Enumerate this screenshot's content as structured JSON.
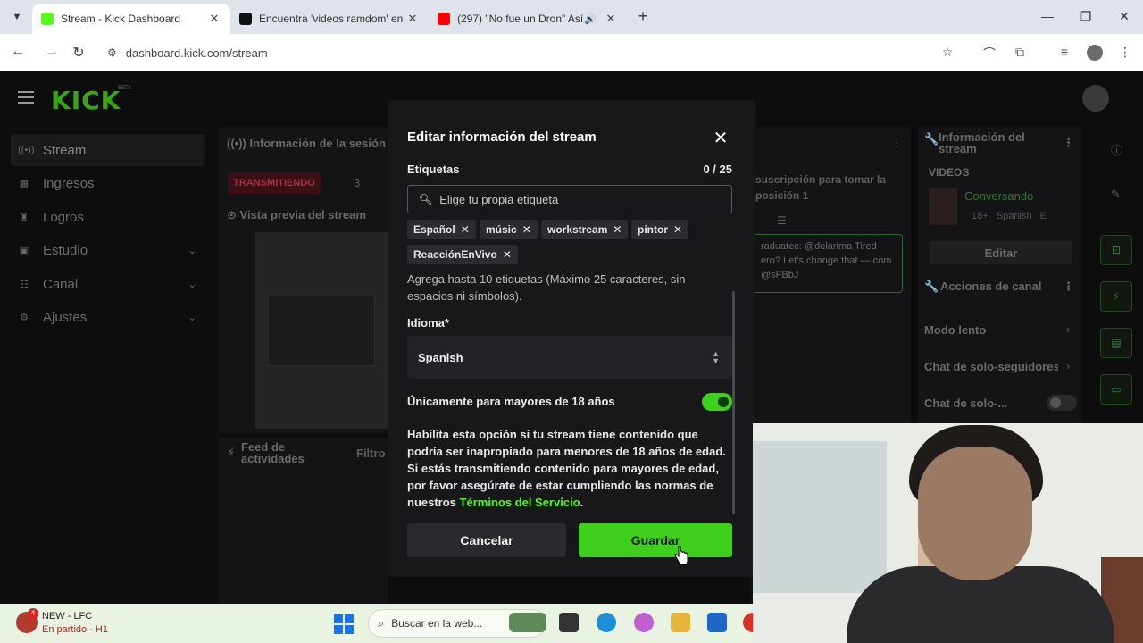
{
  "browser": {
    "tabs": [
      {
        "title": "Stream - Kick Dashboard",
        "active": true,
        "favicon_color": "#53fc18"
      },
      {
        "title": "Encuentra 'videos ramdom' en",
        "active": false,
        "favicon_color": "#111111"
      },
      {
        "title": "(297) \"No fue un Dron\" Así",
        "active": false,
        "favicon_color": "#ff0000"
      }
    ],
    "url": "dashboard.kick.com/stream"
  },
  "app": {
    "logo": "KICK",
    "beta": "BETA",
    "sidebar": [
      {
        "label": "Stream",
        "icon": "radio-icon",
        "active": true
      },
      {
        "label": "Ingresos",
        "icon": "money-icon"
      },
      {
        "label": "Logros",
        "icon": "trophy-icon"
      },
      {
        "label": "Estudio",
        "icon": "studio-icon",
        "expandable": true
      },
      {
        "label": "Canal",
        "icon": "channel-icon",
        "expandable": true
      },
      {
        "label": "Ajustes",
        "icon": "gear-icon",
        "expandable": true
      }
    ],
    "session_title": "Información de la sesión",
    "live_badge": "TRANSMITIENDO",
    "live_count": "3",
    "preview_title": "Vista previa del stream",
    "feed_title": "Feed de actividades",
    "filter_label": "Filtro",
    "chat_top": "suscripción para tomar la posición 1",
    "chat_msg": "raduatec: @delarima Tired ero? Let's change that — com @sFBbJ",
    "right_panel": {
      "title": "Información del stream",
      "videos_label": "VIDEOS",
      "video_title": "Conversando",
      "video_tags": "18+   Spanish   E",
      "edit_label": "Editar",
      "actions_title": "Acciones de canal",
      "actions": [
        "Modo lento",
        "Chat de solo-seguidores",
        "Chat de solo-..."
      ]
    }
  },
  "modal": {
    "title": "Editar información del stream",
    "tags_label": "Etiquetas",
    "tags_counter": "0 / 25",
    "tag_placeholder": "Elige tu propia etiqueta",
    "tags": [
      "Español",
      "músic",
      "workstream",
      "pintor",
      "ReacciónEnVivo"
    ],
    "tags_help": "Agrega hasta 10 etiquetas (Máximo 25 caracteres, sin espacios ni símbolos).",
    "language_label": "Idioma*",
    "language_value": "Spanish",
    "mature_label": "Únicamente para mayores de 18 años",
    "mature_enabled": true,
    "mature_help": "Habilita esta opción si tu stream tiene contenido que podría ser inapropiado para menores de 18 años de edad. Si estás transmitiendo contenido para mayores de edad, por favor asegúrate de estar cumpliendo las normas de nuestros",
    "terms_link": "Términos del Servicio",
    "terms_end": ".",
    "cancel_label": "Cancelar",
    "save_label": "Guardar",
    "accent_color": "#53fc18"
  },
  "taskbar": {
    "notif_count": "4",
    "news_title": "NEW - LFC",
    "news_sub": "En partido - H1",
    "search_placeholder": "Buscar en la web..."
  }
}
